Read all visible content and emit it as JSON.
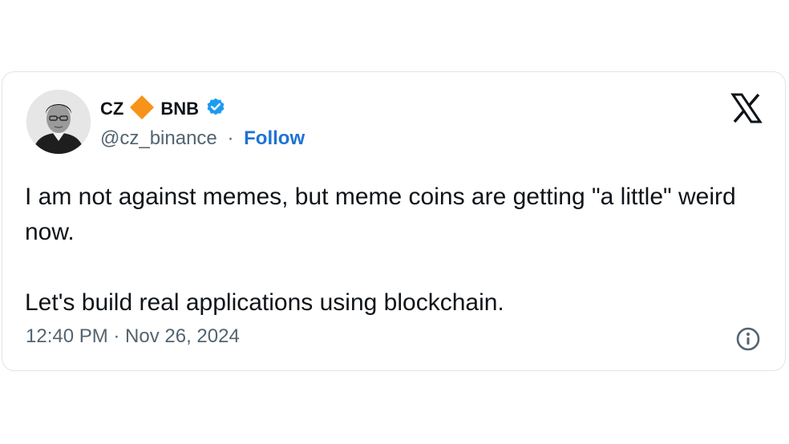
{
  "author": {
    "display_name_first": "CZ",
    "display_name_second": "BNB",
    "handle": "@cz_binance",
    "separator": "·",
    "follow_label": "Follow",
    "verified": true
  },
  "tweet": {
    "line1": "I am not against memes, but meme coins are getting \"a little\" weird now.",
    "line2": "Let's build real applications using blockchain."
  },
  "meta": {
    "timestamp": "12:40 PM · Nov 26, 2024"
  },
  "icons": {
    "diamond": "bnb-diamond-icon",
    "verified": "verified-badge-icon",
    "platform": "x-logo-icon",
    "info": "info-icon"
  },
  "colors": {
    "diamond": "#f7931a",
    "verified": "#1d9bf0",
    "follow": "#1d73d6",
    "text": "#0f1419",
    "secondary": "#536471"
  }
}
